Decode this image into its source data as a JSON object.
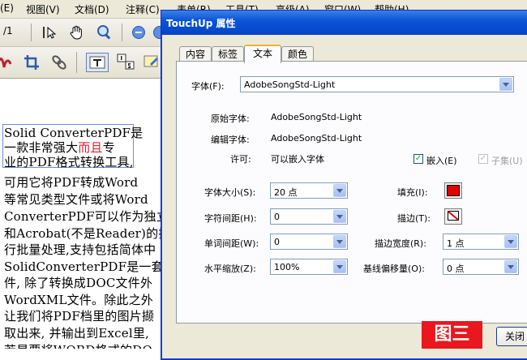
{
  "menu": [
    "(E)",
    "视图(V)",
    "文档(D)",
    "注释(C)",
    "表单(R)",
    "工具(T)",
    "高级(A)",
    "窗口(W)",
    "帮助(H)"
  ],
  "page_indicator": "/1",
  "document_lines": [
    "Solid ConverterPDF是",
    "一款非常强大",
    "而且",
    "专",
    "业的PDF格式转换工具,",
    "可用它将PDF转成Word",
    "等常见类型文件或将Word",
    "ConverterPDF可以作为独立",
    "和Acrobat(不是Reader)的插",
    "行批量处理,支持包括简体中",
    "SolidConverterPDF是一套专",
    "件, 除了转换成DOC文件外",
    "WordXML文件。除此之外",
    "让我们将PDF档里的图片撷",
    "取出来, 并输出到Excel里,",
    "若是要将WORD格式的DO"
  ],
  "dialog": {
    "title": "TouchUp 属性",
    "tabs": [
      "内容",
      "标签",
      "文本",
      "颜色"
    ],
    "active_tab": "文本",
    "font_label": "字体(F):",
    "font_value": "AdobeSongStd-Light",
    "original_font_label": "原始字体:",
    "original_font_value": "AdobeSongStd-Light",
    "edit_font_label": "编辑字体:",
    "edit_font_value": "AdobeSongStd-Light",
    "permission_label": "许可:",
    "permission_value": "可以嵌入字体",
    "embed_label": "嵌入(E)",
    "embed_checked": true,
    "subset_label": "子集(U)",
    "subset_checked": true,
    "size_label": "字体大小(S):",
    "size_value": "20 点",
    "char_spacing_label": "字符间距(H):",
    "char_spacing_value": "0",
    "word_spacing_label": "单词间距(W):",
    "word_spacing_value": "0",
    "hscale_label": "水平缩放(Z):",
    "hscale_value": "100%",
    "fill_label": "填充(I):",
    "fill_color": "#e00000",
    "stroke_label": "描边(T):",
    "stroke_width_label": "描边宽度(R):",
    "stroke_width_value": "1 点",
    "baseline_label": "基线偏移量(O):",
    "baseline_value": "0 点",
    "close_label": "关闭"
  },
  "figure_label": "图三",
  "colors": {
    "titlebar": "#0a55d9",
    "accent_red": "#e8181e",
    "tab_highlight": "#f1b233"
  }
}
